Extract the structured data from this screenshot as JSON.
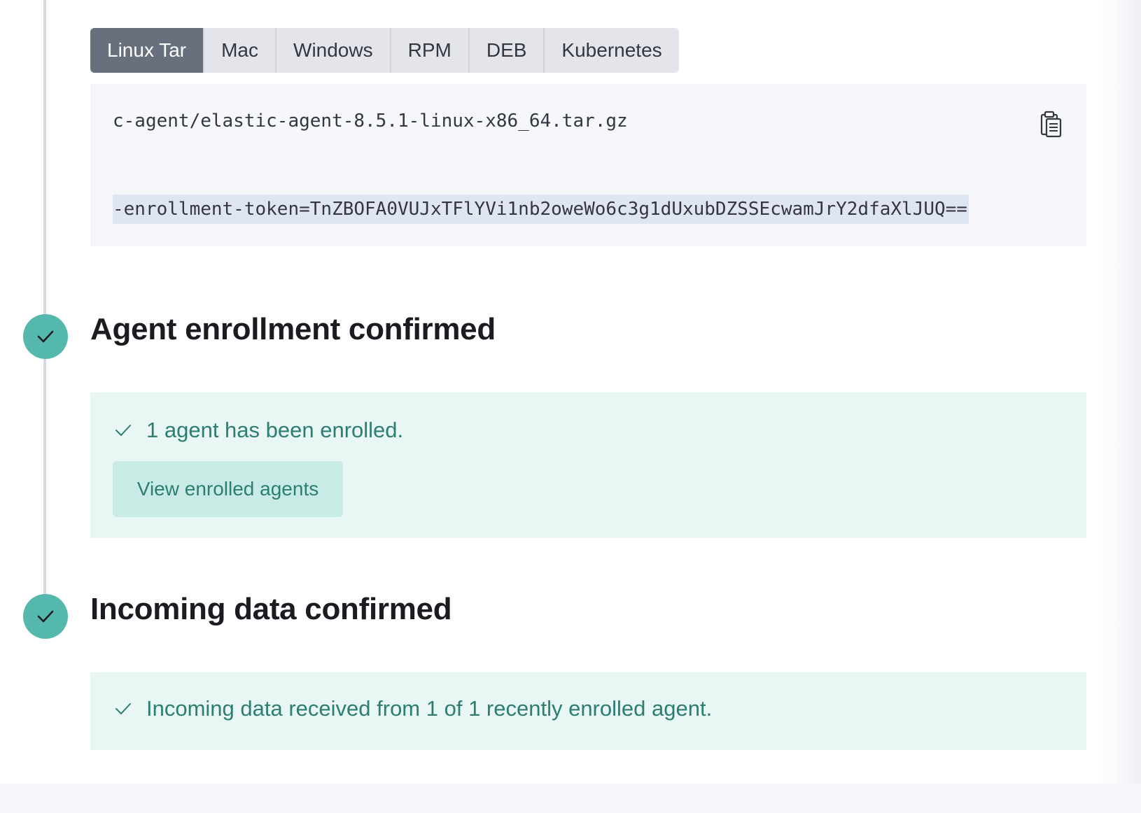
{
  "tabs": [
    {
      "label": "Linux Tar",
      "active": true
    },
    {
      "label": "Mac",
      "active": false
    },
    {
      "label": "Windows",
      "active": false
    },
    {
      "label": "RPM",
      "active": false
    },
    {
      "label": "DEB",
      "active": false
    },
    {
      "label": "Kubernetes",
      "active": false
    }
  ],
  "code": {
    "line1": "c-agent/elastic-agent-8.5.1-linux-x86_64.tar.gz",
    "line2": "-enrollment-token=TnZBOFA0VUJxTFlYVi1nb2oweWo6c3g1dUxubDZSSEcwamJrY2dfaXlJUQ==",
    "copy_icon": "clipboard-icon"
  },
  "steps": {
    "enrollment": {
      "title": "Agent enrollment confirmed",
      "message": "1 agent has been enrolled.",
      "button_label": "View enrolled agents"
    },
    "incoming": {
      "title": "Incoming data confirmed",
      "message": "Incoming data received from 1 of 1 recently enrolled agent."
    }
  },
  "colors": {
    "success": "#54b8ac",
    "success_text": "#2c7e72",
    "callout_bg": "#e8f6f4",
    "tab_active": "#69707d"
  }
}
